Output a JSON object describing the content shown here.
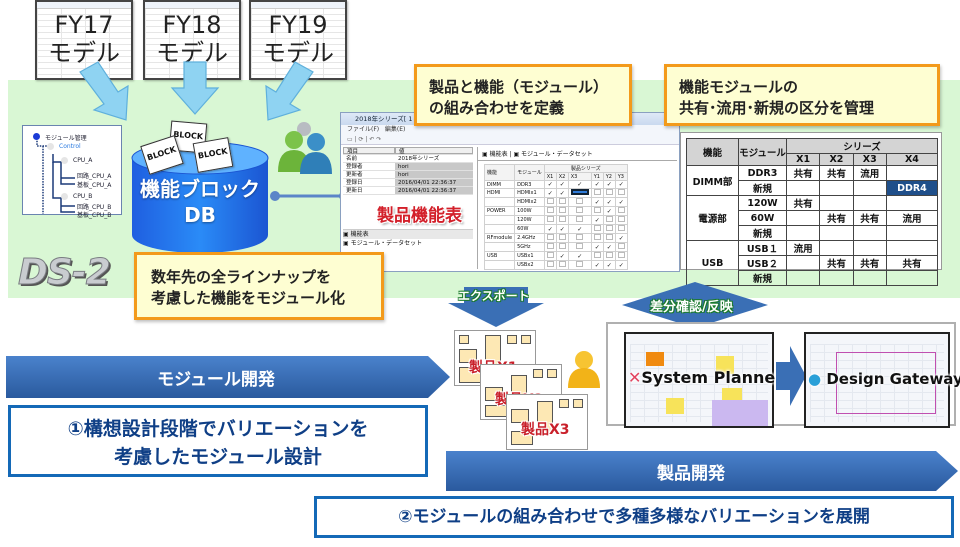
{
  "models": [
    {
      "year": "FY17",
      "label": "モデル"
    },
    {
      "year": "FY18",
      "label": "モデル"
    },
    {
      "year": "FY19",
      "label": "モデル"
    }
  ],
  "tree": {
    "root": "モジュール管理",
    "control": "Control",
    "nodes": [
      "CPU_A",
      "回路_CPU_A",
      "基板_CPU_A",
      "CPU_B",
      "回路_CPU_B",
      "基板_CPU_B"
    ]
  },
  "db": {
    "line1": "機能ブロック",
    "line2": "DB",
    "block_label": "BLOCK"
  },
  "logo": "DS-2",
  "callouts": {
    "modularize": [
      "数年先の全ラインナップを",
      "考慮した機能をモジュール化"
    ],
    "define": [
      "製品と機能（モジュール）",
      "の組み合わせを定義"
    ],
    "manage": [
      "機能モジュールの",
      "共有･流用･新規の区分を管理"
    ]
  },
  "app_window": {
    "title": "2018年シリーズ[ 1 ]",
    "menu": [
      "ファイル(F)",
      "編集(E)"
    ],
    "props_header": [
      "項目",
      "値"
    ],
    "props": [
      {
        "key": "名前",
        "value": "2018年シリーズ"
      },
      {
        "key": "登録者",
        "value": "hori"
      },
      {
        "key": "更新者",
        "value": "hori"
      },
      {
        "key": "登録日",
        "value": "2016/04/01 22:36:37"
      },
      {
        "key": "更新日",
        "value": "2016/04/01 22:36:37"
      }
    ],
    "stamp": "製品機能表",
    "nav_items": [
      "機能表",
      "モジュール・データセット"
    ],
    "tabs": [
      "機能表",
      "モジュール・データセット"
    ],
    "matrix": {
      "headers": [
        "機能",
        "モジュール"
      ],
      "series_label": "製品シリーズ",
      "series": [
        "X1",
        "X2",
        "X3",
        "Y1",
        "Y2",
        "Y3"
      ],
      "rows": [
        {
          "func": "DIMM",
          "module": "DDR3",
          "checks": [
            1,
            1,
            1,
            1,
            1,
            1
          ]
        },
        {
          "func": "HDMI",
          "module": "HDMIx1",
          "checks": [
            1,
            1,
            2,
            0,
            0,
            0
          ]
        },
        {
          "func": "",
          "module": "HDMIx2",
          "checks": [
            0,
            0,
            0,
            1,
            1,
            1
          ]
        },
        {
          "func": "POWER",
          "module": "100W",
          "checks": [
            0,
            0,
            0,
            0,
            1,
            0
          ]
        },
        {
          "func": "",
          "module": "120W",
          "checks": [
            0,
            0,
            0,
            1,
            0,
            0
          ]
        },
        {
          "func": "",
          "module": "60W",
          "checks": [
            1,
            1,
            1,
            0,
            0,
            0
          ]
        },
        {
          "func": "RFmodule",
          "module": "2.4GHz",
          "checks": [
            0,
            0,
            0,
            0,
            0,
            1
          ]
        },
        {
          "func": "",
          "module": "5GHz",
          "checks": [
            0,
            0,
            0,
            1,
            1,
            0
          ]
        },
        {
          "func": "USB",
          "module": "USBx1",
          "checks": [
            0,
            1,
            1,
            0,
            0,
            0
          ]
        },
        {
          "func": "",
          "module": "USBx2",
          "checks": [
            0,
            0,
            0,
            1,
            1,
            1
          ]
        }
      ]
    }
  },
  "share_table": {
    "headers": [
      "機能",
      "モジュール",
      "シリーズ"
    ],
    "series": [
      "X1",
      "X2",
      "X3",
      "X4"
    ],
    "groups": [
      {
        "func": "DIMM部",
        "rows": [
          {
            "module": "DDR3",
            "cells": [
              "共有",
              "共有",
              "流用",
              ""
            ]
          },
          {
            "module": "新規",
            "cells": [
              "",
              "",
              "",
              "DDR4"
            ]
          }
        ]
      },
      {
        "func": "電源部",
        "rows": [
          {
            "module": "120W",
            "cells": [
              "共有",
              "",
              "",
              ""
            ]
          },
          {
            "module": "60W",
            "cells": [
              "",
              "共有",
              "共有",
              "流用"
            ]
          },
          {
            "module": "新規",
            "cells": [
              "",
              "",
              "",
              ""
            ]
          }
        ]
      },
      {
        "func": "USB",
        "rows": [
          {
            "module": "USB１",
            "cells": [
              "流用",
              "",
              "",
              ""
            ]
          },
          {
            "module": "USB２",
            "cells": [
              "",
              "共有",
              "共有",
              "共有"
            ]
          },
          {
            "module": "新規",
            "cells": [
              "",
              "",
              "",
              ""
            ]
          }
        ]
      }
    ]
  },
  "flow": {
    "export": "エクスポート",
    "diff_sync": "差分確認/反映"
  },
  "products": [
    "製品X1",
    "製品X2",
    "製品X3"
  ],
  "tools": [
    "System Planner",
    "Design Gateway"
  ],
  "phases": {
    "module_dev": "モジュール開発",
    "product_dev": "製品開発"
  },
  "points": {
    "p1": [
      "①構想設計段階でバリエーションを",
      "考慮したモジュール設計"
    ],
    "p2": "②モジュールの組み合わせで多種多様なバリエーションを展開"
  },
  "colors": {
    "band": "#d9f7d4",
    "callout_border": "#f39a1b",
    "callout_fill": "#fefed2",
    "phase_blue": "#3a6fb5",
    "frame_blue": "#1469b7",
    "text_navy": "#0f3f86",
    "stamp_red": "#d3202a",
    "highlight": "#1f4f8a"
  }
}
